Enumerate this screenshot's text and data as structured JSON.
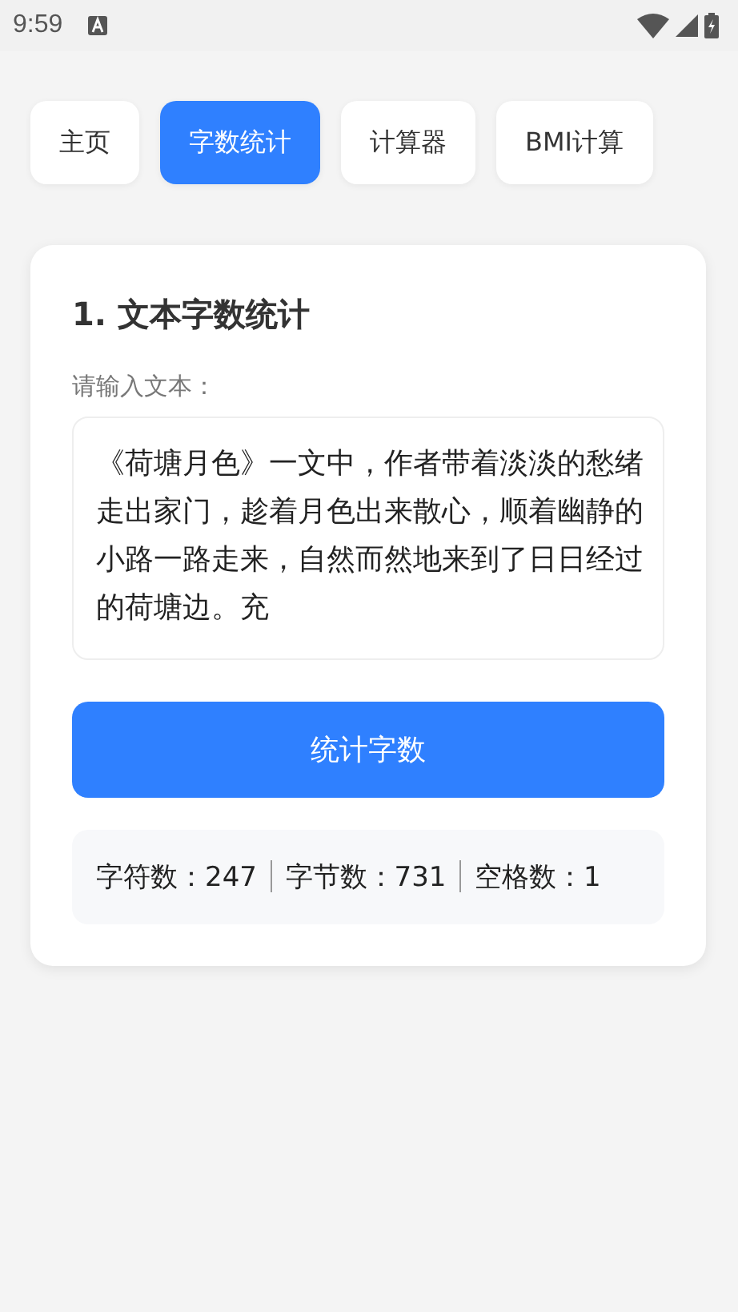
{
  "status_bar": {
    "time": "9:59"
  },
  "tabs": [
    {
      "label": "主页",
      "selected": false
    },
    {
      "label": "字数统计",
      "selected": true
    },
    {
      "label": "计算器",
      "selected": false
    },
    {
      "label": "BMI计算",
      "selected": false
    }
  ],
  "card": {
    "title": "1. 文本字数统计",
    "field_label": "请输入文本：",
    "text_value": "《荷塘月色》一文中，作者带着淡淡的愁绪走出家门，趁着月色出来散心，顺着幽静的小路一路走来，自然而然地来到了日日经过的荷塘边。充",
    "button": "统计字数",
    "stats": [
      "字符数：247",
      "字节数：731",
      "空格数：1"
    ]
  }
}
